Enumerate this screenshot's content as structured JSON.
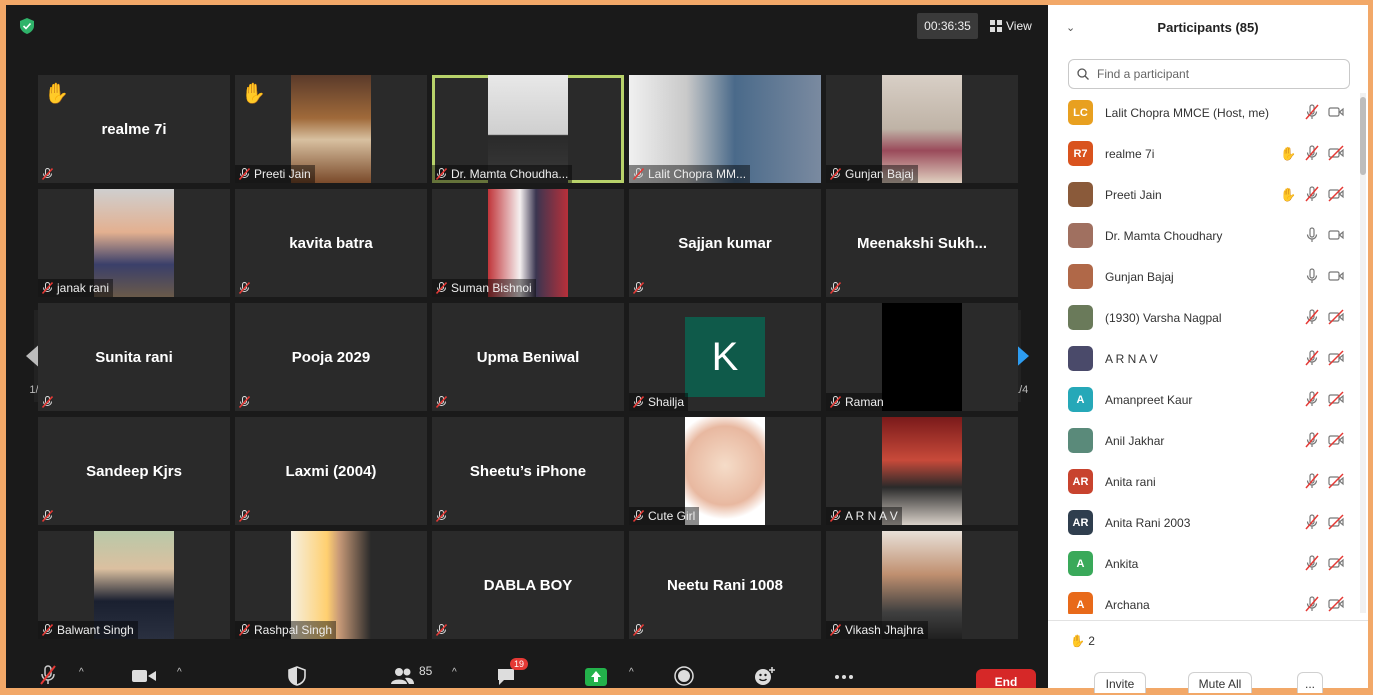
{
  "meeting": {
    "timer": "00:36:35",
    "view_label": "View",
    "page_left": "1/4",
    "page_right": "1/4"
  },
  "tiles": [
    {
      "name": "realme 7i",
      "label": "",
      "hand": true
    },
    {
      "name": "",
      "label": "Preeti Jain",
      "hand": true
    },
    {
      "name": "",
      "label": "Dr. Mamta Choudha...",
      "active": true
    },
    {
      "name": "",
      "label": "Lalit Chopra MM..."
    },
    {
      "name": "",
      "label": "Gunjan Bajaj"
    },
    {
      "name": "",
      "label": "janak rani"
    },
    {
      "name": "kavita batra",
      "label": ""
    },
    {
      "name": "",
      "label": "Suman Bishnoi"
    },
    {
      "name": "Sajjan kumar",
      "label": ""
    },
    {
      "name": "Meenakshi  Sukh...",
      "label": ""
    },
    {
      "name": "Sunita rani",
      "label": ""
    },
    {
      "name": "Pooja 2029",
      "label": ""
    },
    {
      "name": "Upma Beniwal",
      "label": ""
    },
    {
      "name": "",
      "label": "Shailja",
      "avatar_letter": "K"
    },
    {
      "name": "",
      "label": "Raman"
    },
    {
      "name": "Sandeep Kjrs",
      "label": ""
    },
    {
      "name": "Laxmi (2004)",
      "label": ""
    },
    {
      "name": "Sheetu’s iPhone",
      "label": ""
    },
    {
      "name": "",
      "label": "Cute Girl"
    },
    {
      "name": "",
      "label": "A R N A V"
    },
    {
      "name": "",
      "label": "Balwant Singh"
    },
    {
      "name": "",
      "label": "Rashpal Singh"
    },
    {
      "name": "DABLA BOY",
      "label": ""
    },
    {
      "name": "Neetu Rani 1008",
      "label": ""
    },
    {
      "name": "",
      "label": "Vikash Jhajhra"
    }
  ],
  "toolbar": {
    "participants_count": "85",
    "chat_badge": "19",
    "end_label": "End"
  },
  "panel": {
    "title": "Participants (85)",
    "search_placeholder": "Find a participant",
    "hand_count": "2",
    "invite_label": "Invite",
    "mute_all_label": "Mute All",
    "more_label": "..."
  },
  "participants": [
    {
      "initials": "LC",
      "color": "#e8a020",
      "name": "Lalit Chopra MMCE (Host, me)",
      "hand": false,
      "mic": "muted",
      "video": "on"
    },
    {
      "initials": "R7",
      "color": "#d9531e",
      "name": "realme 7i",
      "hand": true,
      "mic": "muted",
      "video": "off"
    },
    {
      "initials": "",
      "color": "#8a5a3a",
      "name": "Preeti Jain",
      "hand": true,
      "mic": "muted",
      "video": "off"
    },
    {
      "initials": "",
      "color": "#a07060",
      "name": "Dr. Mamta Choudhary",
      "hand": false,
      "mic": "on",
      "video": "on"
    },
    {
      "initials": "",
      "color": "#b06848",
      "name": "Gunjan Bajaj",
      "hand": false,
      "mic": "on",
      "video": "on"
    },
    {
      "initials": "",
      "color": "#6a7a5a",
      "name": "(1930) Varsha Nagpal",
      "hand": false,
      "mic": "muted",
      "video": "off"
    },
    {
      "initials": "",
      "color": "#4a4a6a",
      "name": "A R N A V",
      "hand": false,
      "mic": "muted",
      "video": "off"
    },
    {
      "initials": "A",
      "color": "#26a8b8",
      "name": "Amanpreet Kaur",
      "hand": false,
      "mic": "muted",
      "video": "off"
    },
    {
      "initials": "",
      "color": "#5a8a7a",
      "name": "Anil Jakhar",
      "hand": false,
      "mic": "muted",
      "video": "off"
    },
    {
      "initials": "AR",
      "color": "#c8432e",
      "name": "Anita rani",
      "hand": false,
      "mic": "muted",
      "video": "off"
    },
    {
      "initials": "AR",
      "color": "#2f3e4e",
      "name": "Anita Rani 2003",
      "hand": false,
      "mic": "muted",
      "video": "off"
    },
    {
      "initials": "A",
      "color": "#3aa95a",
      "name": "Ankita",
      "hand": false,
      "mic": "muted",
      "video": "off"
    },
    {
      "initials": "A",
      "color": "#e86a1a",
      "name": "Archana",
      "hand": false,
      "mic": "muted",
      "video": "off"
    }
  ]
}
